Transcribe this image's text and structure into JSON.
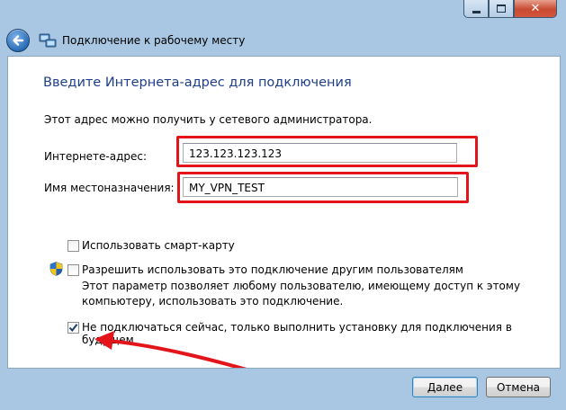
{
  "window": {
    "nav_title": "Подключение к рабочему месту",
    "caption_close": "✕"
  },
  "form": {
    "heading": "Введите Интернета-адрес для подключения",
    "hint": "Этот адрес можно получить у сетевого администратора.",
    "address_label": "Интернете-адрес:",
    "address_value": "123.123.123.123",
    "destination_label": "Имя местоназначения:",
    "destination_value": "MY_VPN_TEST"
  },
  "options": {
    "smartcard": {
      "label": "Использовать смарт-карту",
      "checked": false
    },
    "share": {
      "label": "Разрешить использовать это подключение другим пользователям",
      "checked": false,
      "desc_line1": "Этот параметр позволяет любому пользователю, имеющему доступ к этому",
      "desc_line2": "компьютеру, использовать это подключение."
    },
    "dont_connect": {
      "label": "Не подключаться сейчас, только выполнить установку для подключения в будущем",
      "checked": true
    }
  },
  "buttons": {
    "next": "Далее",
    "cancel": "Отмена"
  },
  "colors": {
    "annotation_red": "#e3151a",
    "heading_blue": "#1e3f87"
  },
  "icons": {
    "back": "back-arrow-icon",
    "network": "network-connection-icon",
    "shield": "uac-shield-icon",
    "check": "checkmark-icon"
  }
}
